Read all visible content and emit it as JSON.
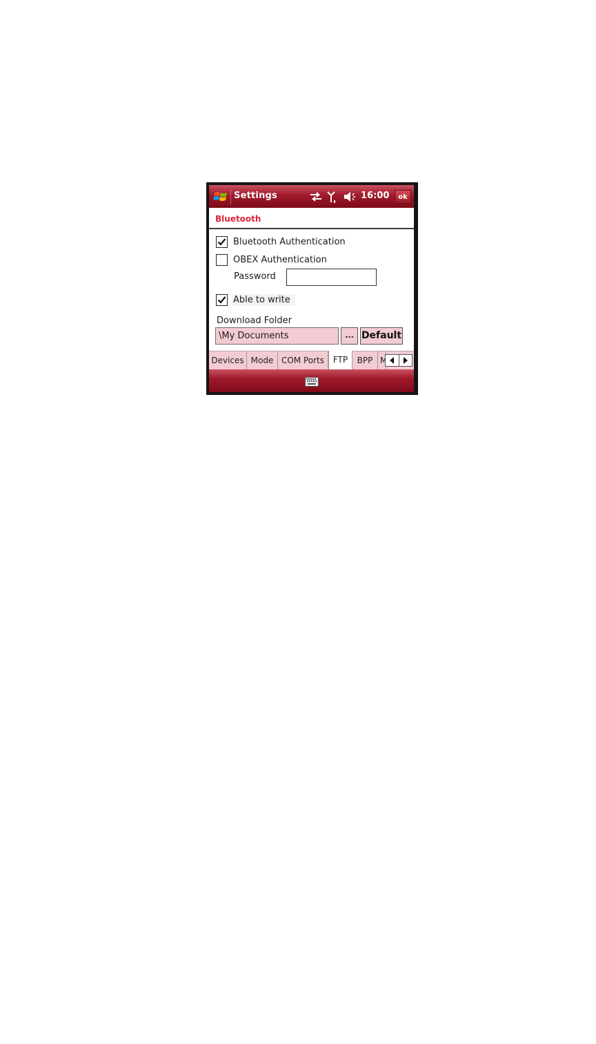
{
  "titlebar": {
    "app_title": "Settings",
    "clock": "16:00",
    "ok_label": "ok",
    "icons": [
      "windows-start-icon",
      "sync-arrows-icon",
      "signal-icon",
      "volume-muted-icon"
    ]
  },
  "header": {
    "title": "Bluetooth"
  },
  "options": {
    "bt_auth": {
      "label": "Bluetooth Authentication",
      "checked": true
    },
    "obex_auth": {
      "label": "OBEX Authentication",
      "checked": false
    },
    "password_label": "Password",
    "password_value": "",
    "able_to_write": {
      "label": "Able to write",
      "checked": true
    }
  },
  "download": {
    "label": "Download Folder",
    "folder_value": "\\My Documents",
    "browse_label": "...",
    "default_label": "Default"
  },
  "tabs": [
    {
      "label": "Devices",
      "active": false
    },
    {
      "label": "Mode",
      "active": false
    },
    {
      "label": "COM Ports",
      "active": false
    },
    {
      "label": "FTP",
      "active": true
    },
    {
      "label": "BPP",
      "active": false
    },
    {
      "label": "M",
      "active": false
    }
  ],
  "softbar": {
    "icon": "keyboard-icon"
  },
  "colors": {
    "title_gradient_top": "#c85060",
    "title_gradient_bottom": "#7d0a1a",
    "header_title": "#e0243c",
    "field_bg": "#f2ccd2"
  }
}
